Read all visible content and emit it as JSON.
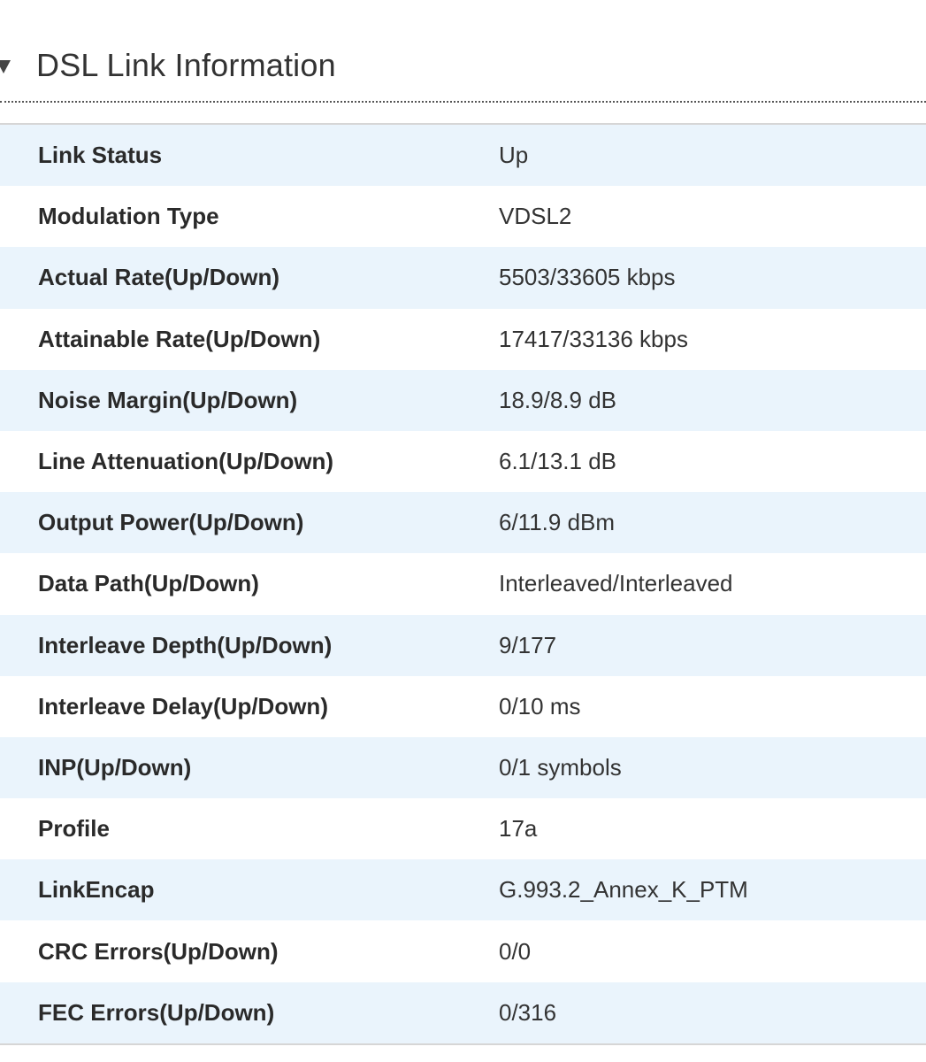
{
  "section": {
    "title": "DSL Link Information",
    "toggle_icon": "caret-down-icon"
  },
  "rows": [
    {
      "label": "Link Status",
      "value": "Up"
    },
    {
      "label": "Modulation Type",
      "value": "VDSL2"
    },
    {
      "label": "Actual Rate(Up/Down)",
      "value": "5503/33605 kbps"
    },
    {
      "label": "Attainable Rate(Up/Down)",
      "value": "17417/33136 kbps"
    },
    {
      "label": "Noise Margin(Up/Down)",
      "value": "18.9/8.9 dB"
    },
    {
      "label": "Line Attenuation(Up/Down)",
      "value": "6.1/13.1 dB"
    },
    {
      "label": "Output Power(Up/Down)",
      "value": "6/11.9 dBm"
    },
    {
      "label": "Data Path(Up/Down)",
      "value": "Interleaved/Interleaved"
    },
    {
      "label": "Interleave Depth(Up/Down)",
      "value": "9/177"
    },
    {
      "label": "Interleave Delay(Up/Down)",
      "value": "0/10 ms"
    },
    {
      "label": "INP(Up/Down)",
      "value": "0/1 symbols"
    },
    {
      "label": "Profile",
      "value": "17a"
    },
    {
      "label": "LinkEncap",
      "value": "G.993.2_Annex_K_PTM"
    },
    {
      "label": "CRC Errors(Up/Down)",
      "value": "0/0"
    },
    {
      "label": "FEC Errors(Up/Down)",
      "value": "0/316"
    }
  ],
  "colors": {
    "row_stripe": "#eaf4fc",
    "row_plain": "#ffffff",
    "label_text": "#2a2a2a",
    "value_text": "#333333"
  }
}
